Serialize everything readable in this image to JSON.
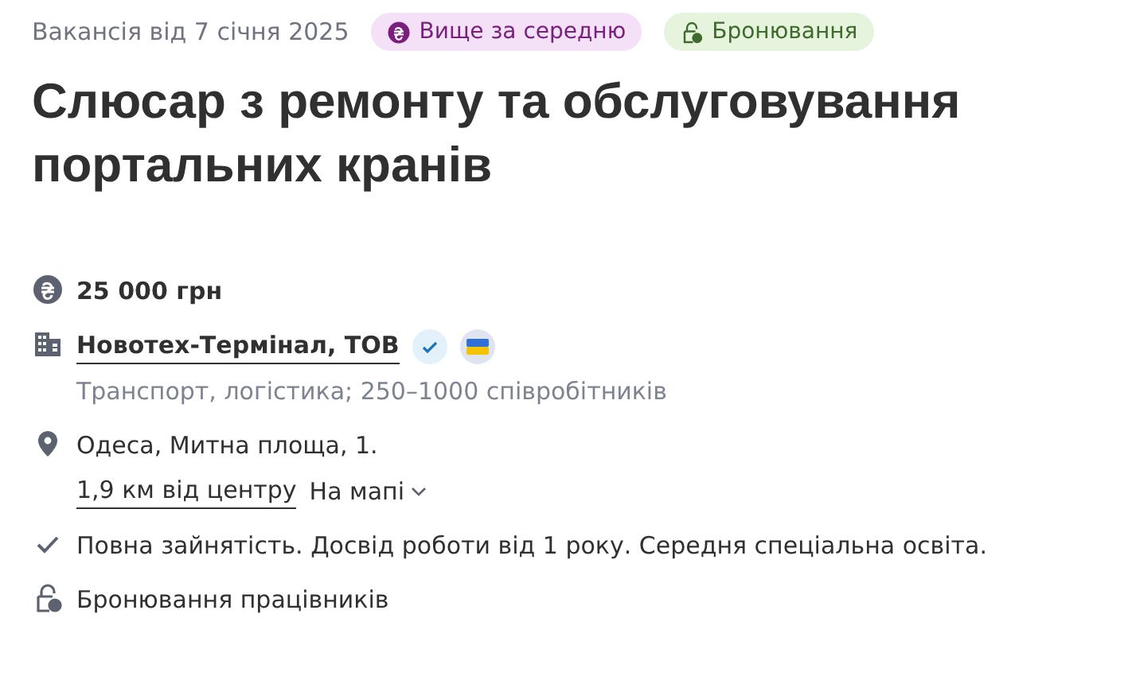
{
  "posted": "Вакансія від 7 січня 2025",
  "badges": [
    {
      "kind": "salary",
      "label": "Вище за середню"
    },
    {
      "kind": "reservation",
      "label": "Бронювання"
    }
  ],
  "title": "Слюсар з ремонту та обслуговування портальних кранів",
  "salary": "25 000 грн",
  "company": {
    "name": "Новотех-Термінал, ТОВ",
    "verified": true,
    "ukrainian": true,
    "info": "Транспорт, логістика; 250–1000 співробітників"
  },
  "location": {
    "address": "Одеса, Митна площа, 1.",
    "distance": "1,9 км від центру",
    "map": "На мапі"
  },
  "requirements": "Повна зайнятість. Досвід роботи від 1 року. Середня спеціальна освіта.",
  "reservation": "Бронювання працівників"
}
